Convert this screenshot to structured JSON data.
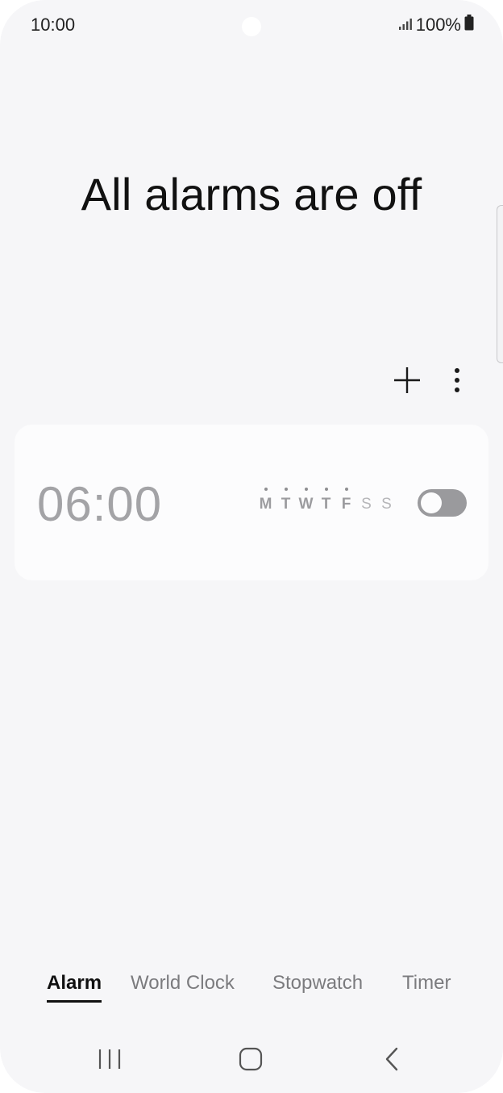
{
  "status_bar": {
    "time": "10:00",
    "battery": "100%",
    "icons": [
      "signal-icon",
      "battery-icon"
    ]
  },
  "heading": "All alarms are off",
  "actions": {
    "add_icon": "plus-icon",
    "more_icon": "more-vertical-icon"
  },
  "alarm": {
    "time": "06:00",
    "days": [
      {
        "label": "M",
        "active": true
      },
      {
        "label": "T",
        "active": true
      },
      {
        "label": "W",
        "active": true
      },
      {
        "label": "T",
        "active": true
      },
      {
        "label": "F",
        "active": true
      },
      {
        "label": "S",
        "active": false
      },
      {
        "label": "S",
        "active": false
      }
    ],
    "enabled": false
  },
  "tabs": [
    {
      "label": "Alarm",
      "active": true
    },
    {
      "label": "World Clock",
      "active": false
    },
    {
      "label": "Stopwatch",
      "active": false
    },
    {
      "label": "Timer",
      "active": false
    }
  ],
  "nav": {
    "recents_icon": "recents-icon",
    "home_icon": "home-icon",
    "back_icon": "back-icon"
  },
  "colors": {
    "background": "#f6f6f8",
    "card": "#fcfcfd",
    "toggle_off": "#9a9a9d",
    "muted_text": "#a3a3a6"
  }
}
